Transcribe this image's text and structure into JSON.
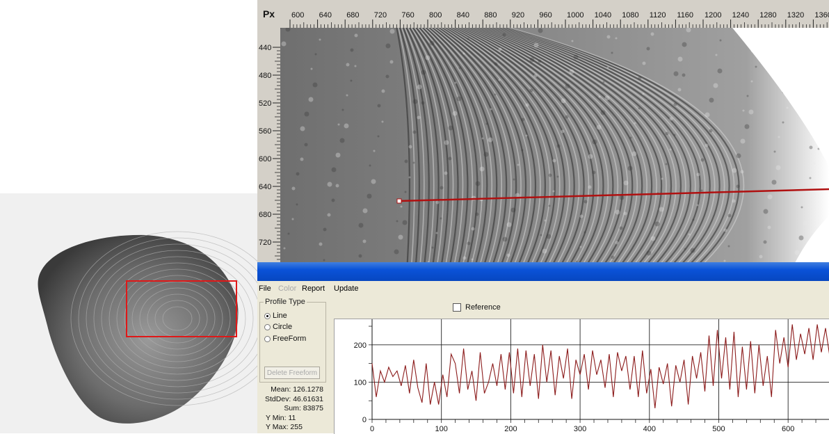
{
  "viewer": {
    "unit_label": "Px",
    "x_ticks": [
      "600",
      "640",
      "680",
      "720",
      "760",
      "800",
      "840",
      "880",
      "920",
      "960",
      "1000",
      "1040",
      "1080",
      "1120",
      "1160",
      "1200",
      "1240",
      "1280",
      "1320",
      "1360"
    ],
    "y_ticks": [
      "440",
      "480",
      "520",
      "560",
      "600",
      "640",
      "680",
      "720"
    ]
  },
  "menu": {
    "file": "File",
    "color": "Color",
    "report": "Report",
    "update": "Update"
  },
  "profile_type": {
    "legend": "Profile Type",
    "options": [
      {
        "label": "Line",
        "selected": true
      },
      {
        "label": "Circle",
        "selected": false
      },
      {
        "label": "FreeForm",
        "selected": false
      }
    ],
    "delete_button": "Delete Freeform"
  },
  "stats": {
    "mean": "Mean: 126.1278",
    "stddev": "StdDev: 46.61631",
    "sum": "Sum: 83875",
    "ymin": "Y Min: 11",
    "ymax": "Y Max: 255"
  },
  "reference": {
    "label": "Reference",
    "checked": false
  },
  "colors": {
    "profile_line": "#8b1a1a",
    "selection_line": "#b01010",
    "thumb_box": "#e01818",
    "title_bar": "#0a52d8"
  },
  "chart_data": {
    "type": "line",
    "xlim": [
      0,
      660
    ],
    "ylim": [
      0,
      265
    ],
    "x_ticks": [
      "0",
      "100",
      "200",
      "300",
      "400",
      "500",
      "600"
    ],
    "y_ticks": [
      "0",
      "100",
      "200"
    ],
    "grid": true,
    "series": [
      {
        "x": [
          0,
          6,
          12,
          18,
          24,
          30,
          36,
          42,
          48,
          54,
          60,
          66,
          72,
          78,
          84,
          90,
          96,
          102,
          108,
          114,
          120,
          126,
          132,
          138,
          144,
          150,
          156,
          162,
          168,
          174,
          180,
          186,
          192,
          198,
          204,
          210,
          216,
          222,
          228,
          234,
          240,
          246,
          252,
          258,
          264,
          270,
          276,
          282,
          288,
          294,
          300,
          306,
          312,
          318,
          324,
          330,
          336,
          342,
          348,
          354,
          360,
          366,
          372,
          378,
          384,
          390,
          396,
          402,
          408,
          414,
          420,
          426,
          432,
          438,
          444,
          450,
          456,
          462,
          468,
          474,
          480,
          486,
          492,
          498,
          504,
          510,
          516,
          522,
          528,
          534,
          540,
          546,
          552,
          558,
          564,
          570,
          576,
          582,
          588,
          594,
          600,
          606,
          612,
          618,
          624,
          630,
          636,
          642,
          648,
          654,
          660
        ],
        "y": [
          150,
          60,
          130,
          100,
          140,
          115,
          130,
          90,
          145,
          70,
          160,
          85,
          45,
          150,
          40,
          100,
          40,
          120,
          60,
          175,
          150,
          70,
          190,
          80,
          130,
          50,
          180,
          70,
          100,
          150,
          90,
          175,
          80,
          180,
          70,
          190,
          60,
          185,
          90,
          175,
          55,
          200,
          100,
          185,
          65,
          170,
          110,
          190,
          55,
          160,
          120,
          175,
          80,
          185,
          120,
          160,
          85,
          175,
          60,
          180,
          130,
          170,
          80,
          170,
          60,
          185,
          70,
          135,
          30,
          140,
          95,
          150,
          35,
          145,
          100,
          160,
          40,
          170,
          110,
          180,
          75,
          225,
          90,
          240,
          110,
          220,
          80,
          235,
          60,
          195,
          80,
          210,
          70,
          200,
          90,
          170,
          60,
          240,
          150,
          220,
          140,
          255,
          160,
          230,
          175,
          245,
          160,
          255,
          180,
          245,
          170
        ]
      }
    ]
  }
}
